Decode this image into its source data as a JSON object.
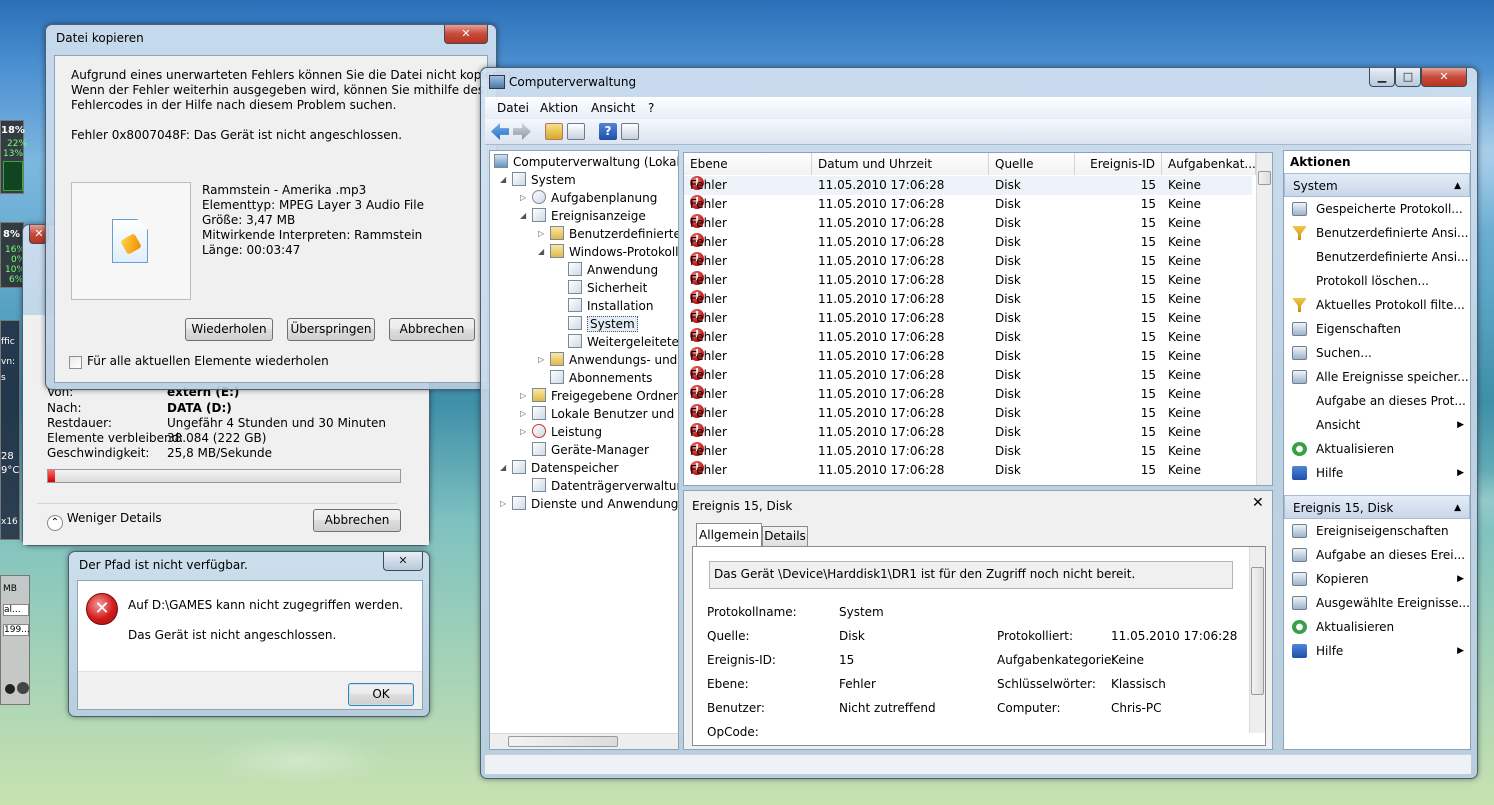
{
  "copyDialog": {
    "title": "Datei kopieren",
    "message": "Aufgrund eines unerwarteten Fehlers können Sie die Datei nicht kopieren. Wenn der Fehler weiterhin ausgegeben wird, können Sie mithilfe des Fehlercodes in der Hilfe nach diesem Problem suchen.",
    "msg_line1": "Aufgrund eines unerwarteten Fehlers können Sie die Datei nicht kopieren.",
    "msg_line2": "Wenn der Fehler weiterhin ausgegeben wird, können Sie mithilfe des",
    "msg_line3": "Fehlercodes in der Hilfe nach diesem Problem suchen.",
    "error": "Fehler 0x8007048F: Das Gerät ist nicht angeschlossen.",
    "file": {
      "name": "Rammstein - Amerika .mp3",
      "type": "Elementtyp: MPEG Layer 3 Audio File",
      "size": "Größe: 3,47 MB",
      "artists": "Mitwirkende Interpreten: Rammstein",
      "length": "Länge: 00:03:47"
    },
    "buttons": {
      "retry": "Wiederholen",
      "skip": "Überspringen",
      "cancel": "Abbrechen"
    },
    "checkbox": "Für alle aktuellen Elemente wiederholen"
  },
  "progress": {
    "from_label": "Von:",
    "from_value": "extern (E:)",
    "to_label": "Nach:",
    "to_value": "DATA (D:)",
    "remaining_label": "Restdauer:",
    "remaining_value": "Ungefähr 4 Stunden und 30 Minuten",
    "items_label": "Elemente verbleibend:",
    "items_value": "38.084 (222 GB)",
    "speed_label": "Geschwindigkeit:",
    "speed_value": "25,8 MB/Sekunde",
    "fraction": 0.02,
    "less_details": "Weniger Details",
    "cancel": "Abbrechen"
  },
  "pathDialog": {
    "title": "Der Pfad ist nicht verfügbar.",
    "line1": "Auf D:\\GAMES kann nicht zugegriffen werden.",
    "line2": "Das Gerät ist nicht angeschlossen.",
    "ok": "OK"
  },
  "gadgets": {
    "cpu1": "18%",
    "cpu1a": "22%",
    "cpu1b": "13%",
    "cpu2": "8%",
    "cpu2a": "16%",
    "cpu2b": "0%",
    "cpu2c": "10%",
    "cpu2d": "6%",
    "t1": "ffic",
    "t2": "vn:",
    "t3": "s",
    "t4": "28",
    "t5": "9°C",
    "t6": "x16",
    "t7": "MB",
    "t8": "al...",
    "t9": "199..."
  },
  "mmc": {
    "title": "Computerverwaltung",
    "menu": [
      "Datei",
      "Aktion",
      "Ansicht",
      "?"
    ],
    "tree": {
      "root": "Computerverwaltung (Lokal)",
      "system": "System",
      "tasks": "Aufgabenplanung",
      "events": "Ereignisanzeige",
      "custom": "Benutzerdefinierte A",
      "winlogs": "Windows-Protokolle",
      "app": "Anwendung",
      "security": "Sicherheit",
      "install": "Installation",
      "sys": "System",
      "forwarded": "Weitergeleitete E",
      "appsvc": "Anwendungs- und D",
      "subs": "Abonnements",
      "shares": "Freigegebene Ordner",
      "users": "Lokale Benutzer und Gr",
      "perf": "Leistung",
      "devmgr": "Geräte-Manager",
      "storage": "Datenspeicher",
      "diskmgmt": "Datenträgerverwaltung",
      "services": "Dienste und Anwendungen"
    },
    "columns": [
      "Ebene",
      "Datum und Uhrzeit",
      "Quelle",
      "Ereignis-ID",
      "Aufgabenkat..."
    ],
    "rows": [
      {
        "level": "Fehler",
        "date": "11.05.2010 17:06:28",
        "source": "Disk",
        "id": "15",
        "cat": "Keine"
      },
      {
        "level": "Fehler",
        "date": "11.05.2010 17:06:28",
        "source": "Disk",
        "id": "15",
        "cat": "Keine"
      },
      {
        "level": "Fehler",
        "date": "11.05.2010 17:06:28",
        "source": "Disk",
        "id": "15",
        "cat": "Keine"
      },
      {
        "level": "Fehler",
        "date": "11.05.2010 17:06:28",
        "source": "Disk",
        "id": "15",
        "cat": "Keine"
      },
      {
        "level": "Fehler",
        "date": "11.05.2010 17:06:28",
        "source": "Disk",
        "id": "15",
        "cat": "Keine"
      },
      {
        "level": "Fehler",
        "date": "11.05.2010 17:06:28",
        "source": "Disk",
        "id": "15",
        "cat": "Keine"
      },
      {
        "level": "Fehler",
        "date": "11.05.2010 17:06:28",
        "source": "Disk",
        "id": "15",
        "cat": "Keine"
      },
      {
        "level": "Fehler",
        "date": "11.05.2010 17:06:28",
        "source": "Disk",
        "id": "15",
        "cat": "Keine"
      },
      {
        "level": "Fehler",
        "date": "11.05.2010 17:06:28",
        "source": "Disk",
        "id": "15",
        "cat": "Keine"
      },
      {
        "level": "Fehler",
        "date": "11.05.2010 17:06:28",
        "source": "Disk",
        "id": "15",
        "cat": "Keine"
      },
      {
        "level": "Fehler",
        "date": "11.05.2010 17:06:28",
        "source": "Disk",
        "id": "15",
        "cat": "Keine"
      },
      {
        "level": "Fehler",
        "date": "11.05.2010 17:06:28",
        "source": "Disk",
        "id": "15",
        "cat": "Keine"
      },
      {
        "level": "Fehler",
        "date": "11.05.2010 17:06:28",
        "source": "Disk",
        "id": "15",
        "cat": "Keine"
      },
      {
        "level": "Fehler",
        "date": "11.05.2010 17:06:28",
        "source": "Disk",
        "id": "15",
        "cat": "Keine"
      },
      {
        "level": "Fehler",
        "date": "11.05.2010 17:06:28",
        "source": "Disk",
        "id": "15",
        "cat": "Keine"
      },
      {
        "level": "Fehler",
        "date": "11.05.2010 17:06:28",
        "source": "Disk",
        "id": "15",
        "cat": "Keine"
      }
    ],
    "detail": {
      "title": "Ereignis 15, Disk",
      "tab_general": "Allgemein",
      "tab_details": "Details",
      "message": "Das Gerät \\Device\\Harddisk1\\DR1 ist für den Zugriff noch nicht bereit.",
      "log_label": "Protokollname:",
      "log_value": "System",
      "source_label": "Quelle:",
      "source_value": "Disk",
      "logged_label": "Protokolliert:",
      "logged_value": "11.05.2010 17:06:28",
      "id_label": "Ereignis-ID:",
      "id_value": "15",
      "cat_label": "Aufgabenkategorie:",
      "cat_value": "Keine",
      "level_label": "Ebene:",
      "level_value": "Fehler",
      "keywords_label": "Schlüsselwörter:",
      "keywords_value": "Klassisch",
      "user_label": "Benutzer:",
      "user_value": "Nicht zutreffend",
      "computer_label": "Computer:",
      "computer_value": "Chris-PC",
      "opcode_label": "OpCode:"
    },
    "actions": {
      "header": "Aktionen",
      "sec1": "System",
      "items1": [
        "Gespeicherte Protokoll...",
        "Benutzerdefinierte Ansi...",
        "Benutzerdefinierte Ansi...",
        "Protokoll löschen...",
        "Aktuelles Protokoll filte...",
        "Eigenschaften",
        "Suchen...",
        "Alle Ereignisse speicher...",
        "Aufgabe an dieses Prot...",
        "Ansicht",
        "Aktualisieren",
        "Hilfe"
      ],
      "sec2": "Ereignis 15, Disk",
      "items2": [
        "Ereigniseigenschaften",
        "Aufgabe an dieses Erei...",
        "Kopieren",
        "Ausgewählte Ereignisse...",
        "Aktualisieren",
        "Hilfe"
      ]
    }
  }
}
